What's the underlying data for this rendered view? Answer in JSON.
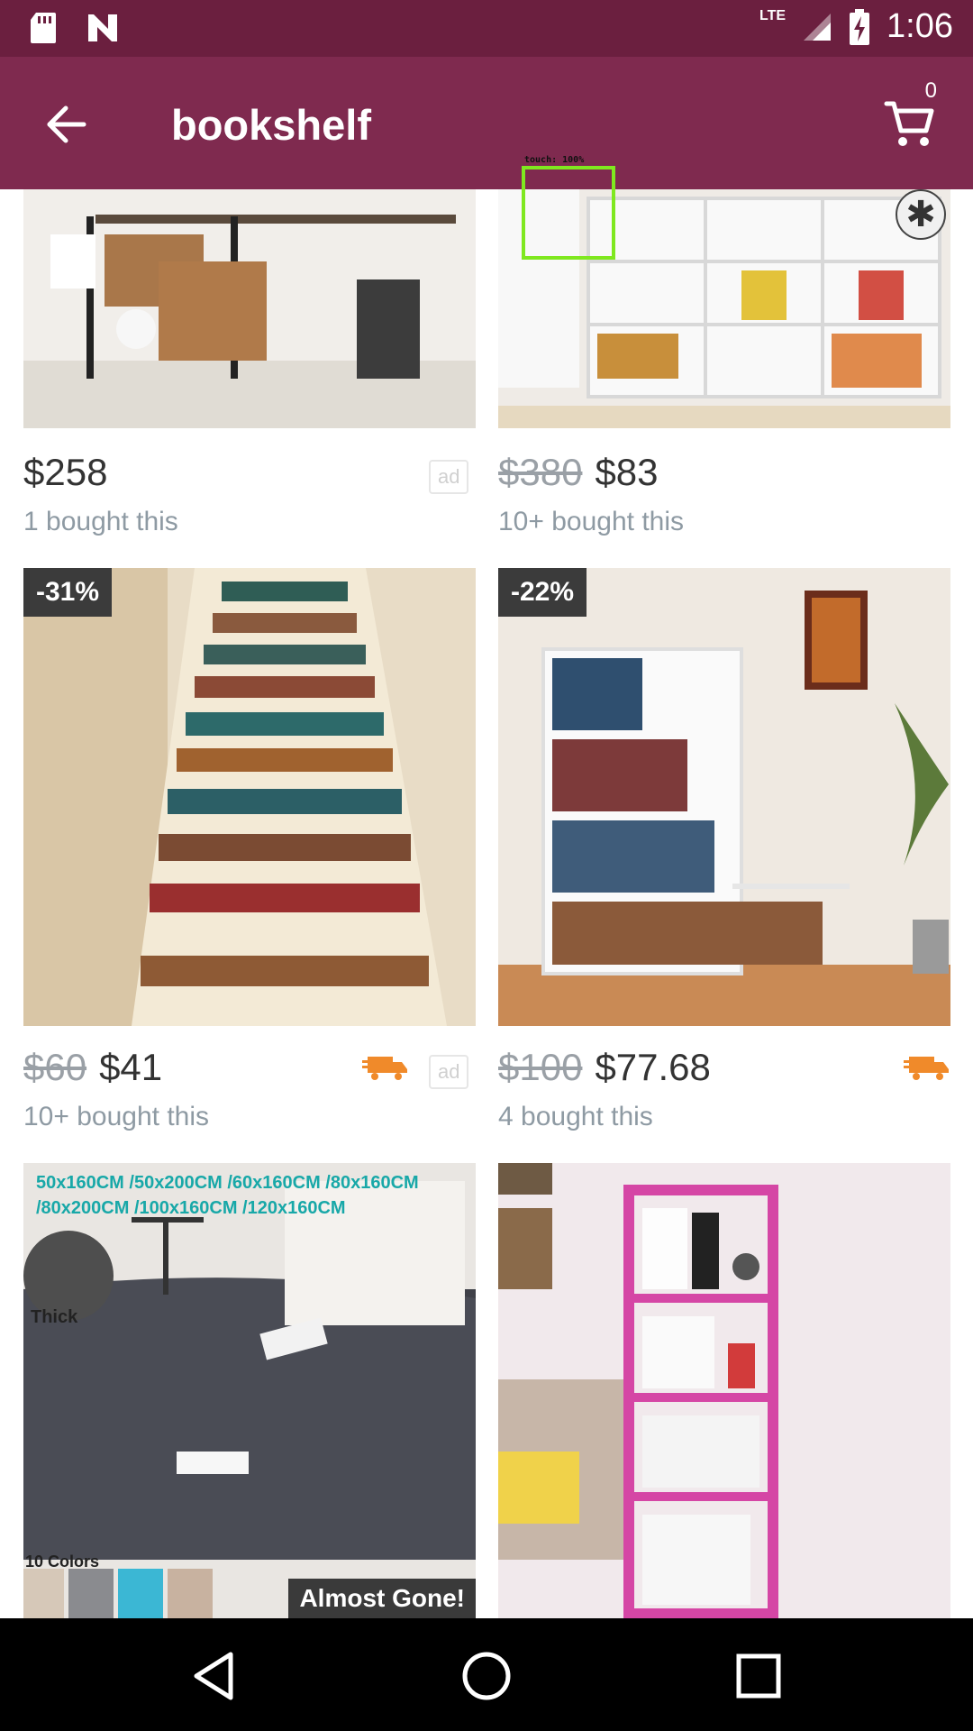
{
  "status_bar": {
    "time": "1:06",
    "network": "LTE",
    "icons": [
      "sd-card-icon",
      "n-notification-icon",
      "signal-icon",
      "battery-charging-icon"
    ]
  },
  "app_bar": {
    "title": "bookshelf",
    "cart_count": "0",
    "icons": [
      "back-arrow-icon",
      "cart-icon"
    ]
  },
  "overlay": {
    "touch_label": "touch: 100%"
  },
  "products": [
    {
      "price": "$258",
      "old_price": "",
      "bought": "1 bought this",
      "ad": "ad"
    },
    {
      "price": "$83",
      "old_price": "$380",
      "bought": "10+ bought this"
    },
    {
      "discount": "-31%",
      "price": "$41",
      "old_price": "$60",
      "bought": "10+ bought this",
      "ad": "ad",
      "icon": "delivery-truck-icon"
    },
    {
      "discount": "-22%",
      "price": "$77.68",
      "old_price": "$100",
      "bought": "4 bought this",
      "icon": "delivery-truck-icon"
    },
    {
      "image_text_top": "50x160CM /50x200CM /60x160CM /80x160CM /80x200CM /100x160CM /120x160CM",
      "image_text_thick": "Thick",
      "image_text_colors": "10 Colors",
      "badge": "Almost Gone!"
    },
    {
      "image_text_top": ""
    }
  ],
  "nav_bar": {
    "icons": [
      "back-triangle-icon",
      "home-circle-icon",
      "recents-square-icon"
    ]
  }
}
